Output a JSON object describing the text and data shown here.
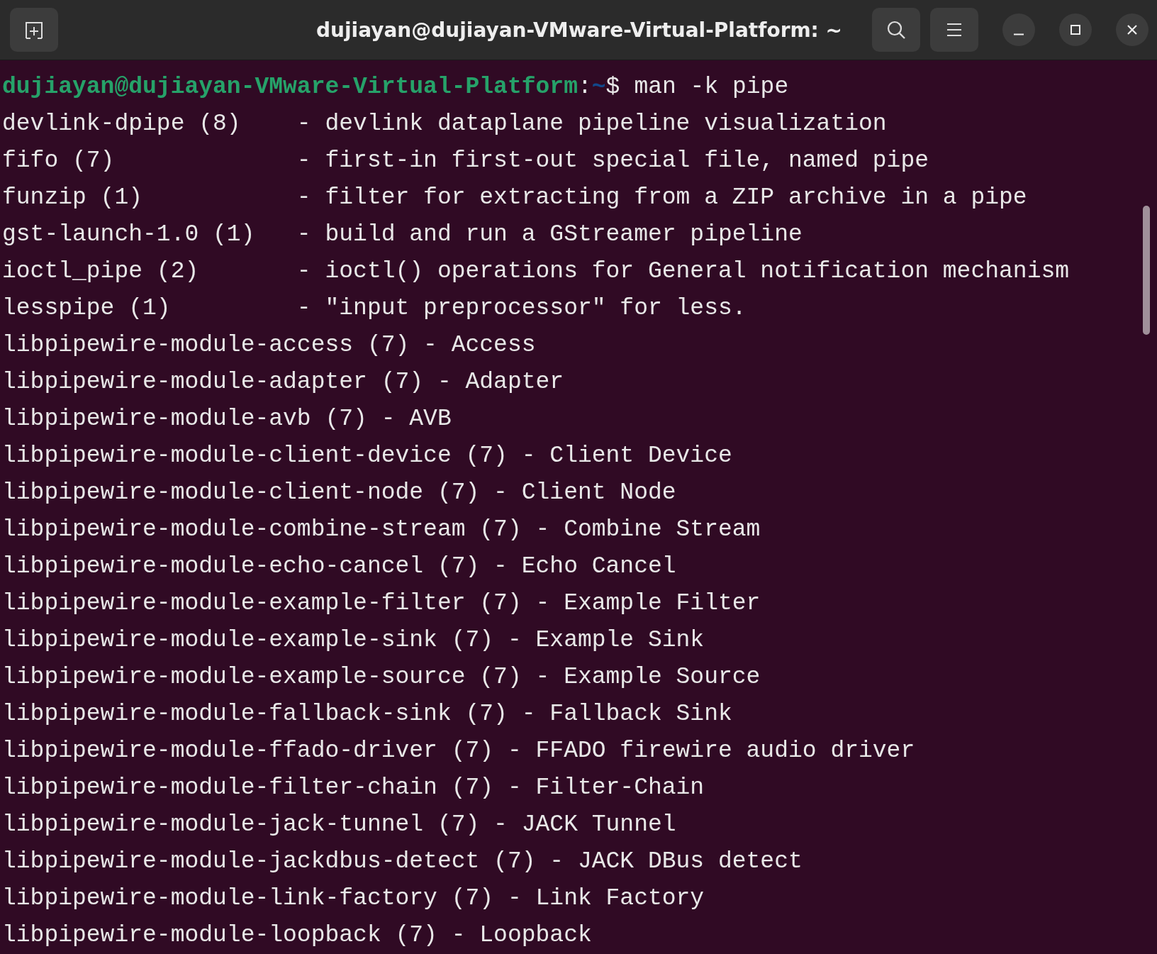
{
  "window": {
    "title": "dujiayan@dujiayan-VMware-Virtual-Platform: ~"
  },
  "prompt": {
    "user_host": "dujiayan@dujiayan-VMware-Virtual-Platform",
    "separator": ":",
    "path": "~",
    "symbol": "$",
    "command": "man -k pipe"
  },
  "output_lines": [
    "devlink-dpipe (8)    - devlink dataplane pipeline visualization",
    "fifo (7)             - first-in first-out special file, named pipe",
    "funzip (1)           - filter for extracting from a ZIP archive in a pipe",
    "gst-launch-1.0 (1)   - build and run a GStreamer pipeline",
    "ioctl_pipe (2)       - ioctl() operations for General notification mechanism",
    "lesspipe (1)         - \"input preprocessor\" for less.",
    "libpipewire-module-access (7) - Access",
    "libpipewire-module-adapter (7) - Adapter",
    "libpipewire-module-avb (7) - AVB",
    "libpipewire-module-client-device (7) - Client Device",
    "libpipewire-module-client-node (7) - Client Node",
    "libpipewire-module-combine-stream (7) - Combine Stream",
    "libpipewire-module-echo-cancel (7) - Echo Cancel",
    "libpipewire-module-example-filter (7) - Example Filter",
    "libpipewire-module-example-sink (7) - Example Sink",
    "libpipewire-module-example-source (7) - Example Source",
    "libpipewire-module-fallback-sink (7) - Fallback Sink",
    "libpipewire-module-ffado-driver (7) - FFADO firewire audio driver",
    "libpipewire-module-filter-chain (7) - Filter-Chain",
    "libpipewire-module-jack-tunnel (7) - JACK Tunnel",
    "libpipewire-module-jackdbus-detect (7) - JACK DBus detect",
    "libpipewire-module-link-factory (7) - Link Factory",
    "libpipewire-module-loopback (7) - Loopback"
  ]
}
